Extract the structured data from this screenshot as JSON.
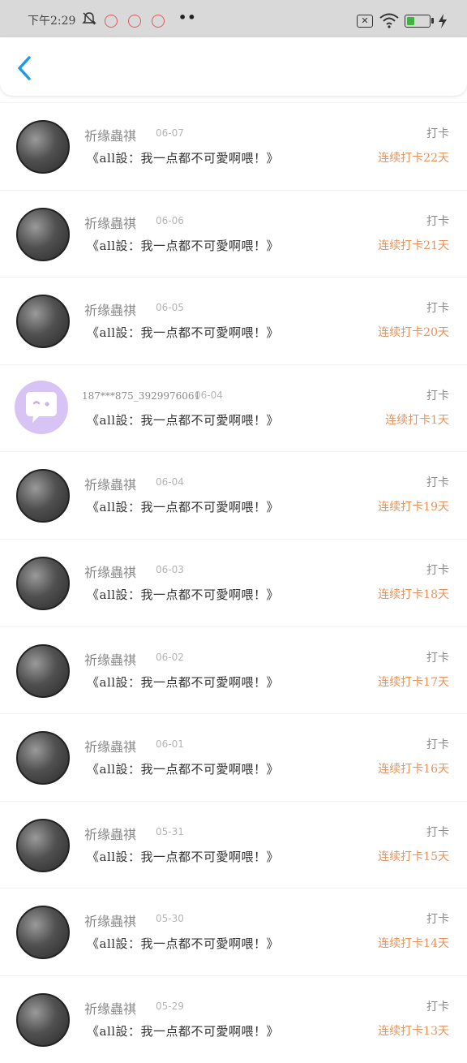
{
  "status_bar": {
    "time": "下午2:29",
    "icons": [
      "bell-off-icon",
      "notification-icon",
      "notification-icon",
      "notification-icon",
      "more-icon",
      "sim-x-icon",
      "wifi-icon",
      "battery-icon",
      "charging-icon"
    ],
    "more": "••",
    "sim": "✕",
    "battery_level": 0.35,
    "battery_color": "#3fb53f"
  },
  "header": {
    "back_icon": "chevron-left-icon",
    "back_color": "#1e9be6"
  },
  "feed": [
    {
      "user": "祈缘蟲祺",
      "date": "06-07",
      "quote": "《all設：我一点都不可愛啊喂！》",
      "type": "打卡",
      "streak": "连续打卡22天",
      "avatar": "photo"
    },
    {
      "user": "祈缘蟲祺",
      "date": "06-06",
      "quote": "《all設：我一点都不可愛啊喂！》",
      "type": "打卡",
      "streak": "连续打卡21天",
      "avatar": "photo"
    },
    {
      "user": "祈缘蟲祺",
      "date": "06-05",
      "quote": "《all設：我一点都不可愛啊喂！》",
      "type": "打卡",
      "streak": "连续打卡20天",
      "avatar": "photo"
    },
    {
      "user": "187***875_3929976061",
      "date": "06-04",
      "quote": "《all設：我一点都不可愛啊喂！》",
      "type": "打卡",
      "streak": "连续打卡1天",
      "avatar": "bot"
    },
    {
      "user": "祈缘蟲祺",
      "date": "06-04",
      "quote": "《all設：我一点都不可愛啊喂！》",
      "type": "打卡",
      "streak": "连续打卡19天",
      "avatar": "photo"
    },
    {
      "user": "祈缘蟲祺",
      "date": "06-03",
      "quote": "《all設：我一点都不可愛啊喂！》",
      "type": "打卡",
      "streak": "连续打卡18天",
      "avatar": "photo"
    },
    {
      "user": "祈缘蟲祺",
      "date": "06-02",
      "quote": "《all設：我一点都不可愛啊喂！》",
      "type": "打卡",
      "streak": "连续打卡17天",
      "avatar": "photo"
    },
    {
      "user": "祈缘蟲祺",
      "date": "06-01",
      "quote": "《all設：我一点都不可愛啊喂！》",
      "type": "打卡",
      "streak": "连续打卡16天",
      "avatar": "photo"
    },
    {
      "user": "祈缘蟲祺",
      "date": "05-31",
      "quote": "《all設：我一点都不可愛啊喂！》",
      "type": "打卡",
      "streak": "连续打卡15天",
      "avatar": "photo"
    },
    {
      "user": "祈缘蟲祺",
      "date": "05-30",
      "quote": "《all設：我一点都不可愛啊喂！》",
      "type": "打卡",
      "streak": "连续打卡14天",
      "avatar": "photo"
    },
    {
      "user": "祈缘蟲祺",
      "date": "05-29",
      "quote": "《all設：我一点都不可愛啊喂！》",
      "type": "打卡",
      "streak": "连续打卡13天",
      "avatar": "photo"
    }
  ],
  "colors": {
    "streak": "#e8925a",
    "meta": "#8a8a8a",
    "date": "#b4b4b4",
    "bot_avatar": "#d7c4f5"
  }
}
